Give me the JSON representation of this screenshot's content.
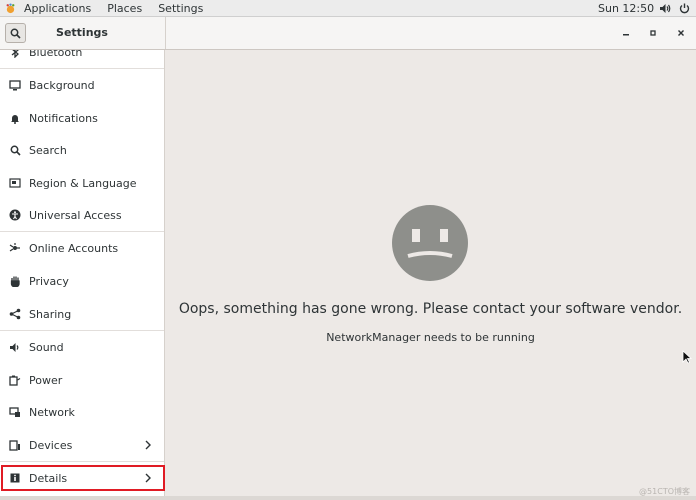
{
  "topbar": {
    "applications": "Applications",
    "places": "Places",
    "settings": "Settings",
    "clock": "Sun 12:50",
    "icons": [
      "volume-icon",
      "power-icon"
    ]
  },
  "header": {
    "title": "Settings",
    "search_icon": "search-icon",
    "minimize": "–",
    "maximize": "▫",
    "close": "✕"
  },
  "sidebar": {
    "items": [
      {
        "label": "Bluetooth",
        "icon": "bluetooth-icon"
      },
      {
        "label": "Background",
        "icon": "background-icon"
      },
      {
        "label": "Notifications",
        "icon": "bell-icon"
      },
      {
        "label": "Search",
        "icon": "search-icon"
      },
      {
        "label": "Region & Language",
        "icon": "region-icon"
      },
      {
        "label": "Universal Access",
        "icon": "accessibility-icon"
      },
      {
        "label": "Online Accounts",
        "icon": "online-accounts-icon"
      },
      {
        "label": "Privacy",
        "icon": "hand-icon"
      },
      {
        "label": "Sharing",
        "icon": "share-icon"
      },
      {
        "label": "Sound",
        "icon": "speaker-icon"
      },
      {
        "label": "Power",
        "icon": "battery-icon"
      },
      {
        "label": "Network",
        "icon": "network-icon"
      },
      {
        "label": "Devices",
        "icon": "devices-icon"
      },
      {
        "label": "Details",
        "icon": "info-icon",
        "selected": true
      }
    ]
  },
  "content": {
    "error_title": "Oops, something has gone wrong. Please contact your software vendor.",
    "error_message": "NetworkManager needs to be running"
  },
  "watermark": "@51CTO博客",
  "colors": {
    "highlight": "#e01b24",
    "content_bg": "#ede9e6",
    "sad_face": "#8e8f8b"
  }
}
